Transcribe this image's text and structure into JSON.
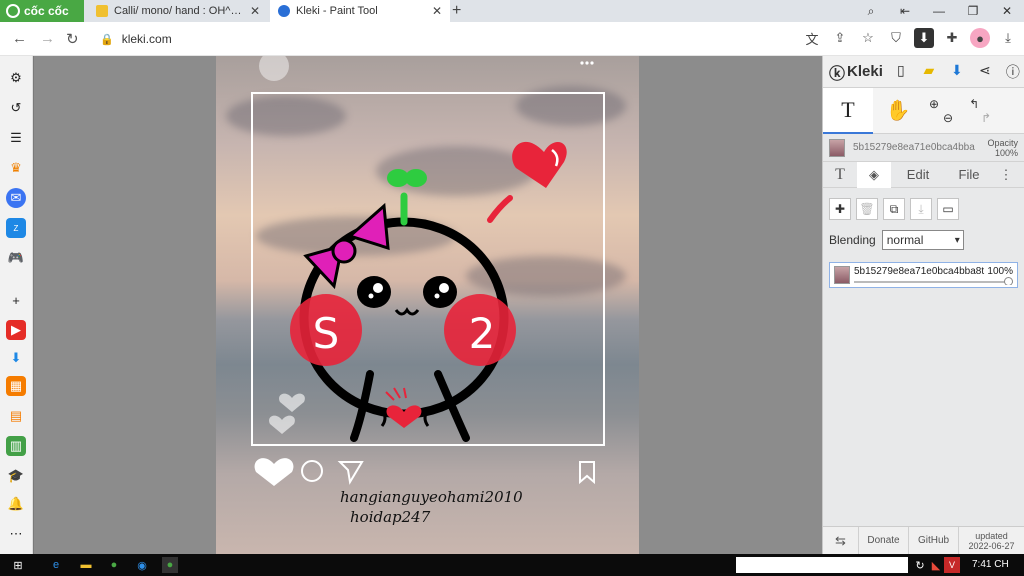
{
  "browser": {
    "brand": "cốc cốc",
    "tabs": [
      {
        "title": "Calli/ mono/ hand : OH^^ . v"
      },
      {
        "title": "Kleki - Paint Tool"
      }
    ],
    "url": "kleki.com"
  },
  "canvas": {
    "handwriting_line1": "hangianguyeohami2010",
    "handwriting_line2": "hoidap247",
    "cheek_left": "S",
    "cheek_right": "2"
  },
  "kleki": {
    "logo": "Kleki",
    "layer_file": "5b15279e8ea71e0bca4bba",
    "opacity_label": "Opacity",
    "opacity_value": "100%",
    "tabs": {
      "edit": "Edit",
      "file": "File"
    },
    "blending_label": "Blending",
    "blending_value": "normal",
    "layer_item": {
      "name": "5b15279e8ea71e0bca4bba8t",
      "opacity": "100%"
    },
    "footer": {
      "donate": "Donate",
      "github": "GitHub",
      "updated_label": "updated",
      "updated_date": "2022-06-27"
    }
  },
  "taskbar": {
    "time": "7:41 CH"
  },
  "colors": {
    "brand_green": "#49a844",
    "accent_blue": "#3a78d8",
    "heart_red": "#e8243a",
    "bow_pink": "#e020b8"
  }
}
